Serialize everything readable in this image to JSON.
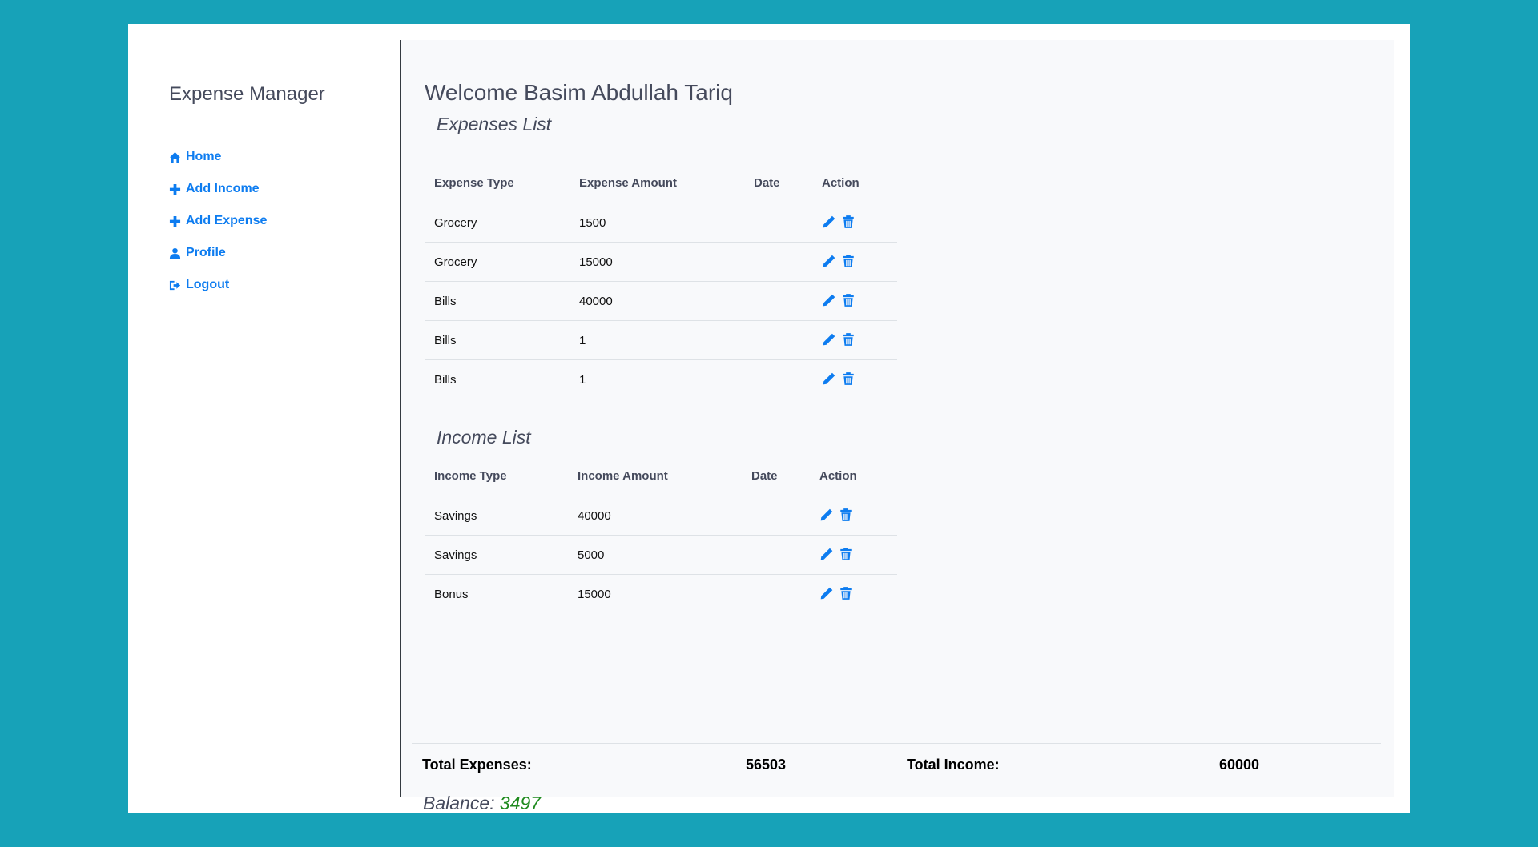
{
  "app": {
    "title": "Expense Manager"
  },
  "sidebar": {
    "items": [
      {
        "label": "Home",
        "icon": "home-icon"
      },
      {
        "label": "Add Income",
        "icon": "plus-icon"
      },
      {
        "label": "Add Expense",
        "icon": "plus-icon"
      },
      {
        "label": "Profile",
        "icon": "user-icon"
      },
      {
        "label": "Logout",
        "icon": "logout-icon"
      }
    ]
  },
  "main": {
    "welcome": "Welcome Basim Abdullah Tariq",
    "expenses": {
      "title": "Expenses List",
      "headers": [
        "Expense Type",
        "Expense Amount",
        "Date",
        "Action"
      ],
      "rows": [
        {
          "type": "Grocery",
          "amount": "1500",
          "date": ""
        },
        {
          "type": "Grocery",
          "amount": "15000",
          "date": ""
        },
        {
          "type": "Bills",
          "amount": "40000",
          "date": ""
        },
        {
          "type": "Bills",
          "amount": "1",
          "date": ""
        },
        {
          "type": "Bills",
          "amount": "1",
          "date": ""
        }
      ]
    },
    "income": {
      "title": "Income List",
      "headers": [
        "Income Type",
        "Income Amount",
        "Date",
        "Action"
      ],
      "rows": [
        {
          "type": "Savings",
          "amount": "40000",
          "date": ""
        },
        {
          "type": "Savings",
          "amount": "5000",
          "date": ""
        },
        {
          "type": "Bonus",
          "amount": "15000",
          "date": ""
        }
      ]
    },
    "totals": {
      "expenses_label": "Total Expenses:",
      "expenses_value": "56503",
      "income_label": "Total Income:",
      "income_value": "60000",
      "balance_label": "Balance:",
      "balance_value": "3497"
    }
  },
  "colors": {
    "background": "#17a2b8",
    "accent": "#0d7cf0",
    "balance": "#1e8a1e"
  }
}
